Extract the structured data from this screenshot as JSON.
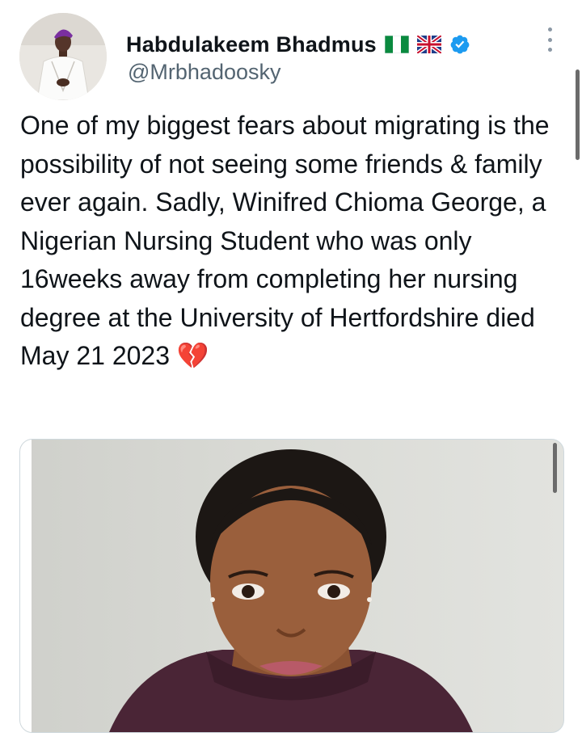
{
  "author": {
    "display_name": "Habdulakeem Bhadmus",
    "handle": "@Mrbhadoosky",
    "flags": [
      "nigeria-flag",
      "uk-flag"
    ],
    "verified": true
  },
  "tweet": {
    "text": "One of my biggest fears about migrating is the possibility of not seeing some friends & family ever again. Sadly, Winifred Chioma George, a Nigerian Nursing Student who was only 16weeks away from completing her nursing degree at the University of Hertfordshire died May 21 2023",
    "emoji": "💔"
  },
  "colors": {
    "text": "#0f1419",
    "secondary": "#536471",
    "verified_blue": "#1d9bf0",
    "border": "#cfd9de"
  }
}
